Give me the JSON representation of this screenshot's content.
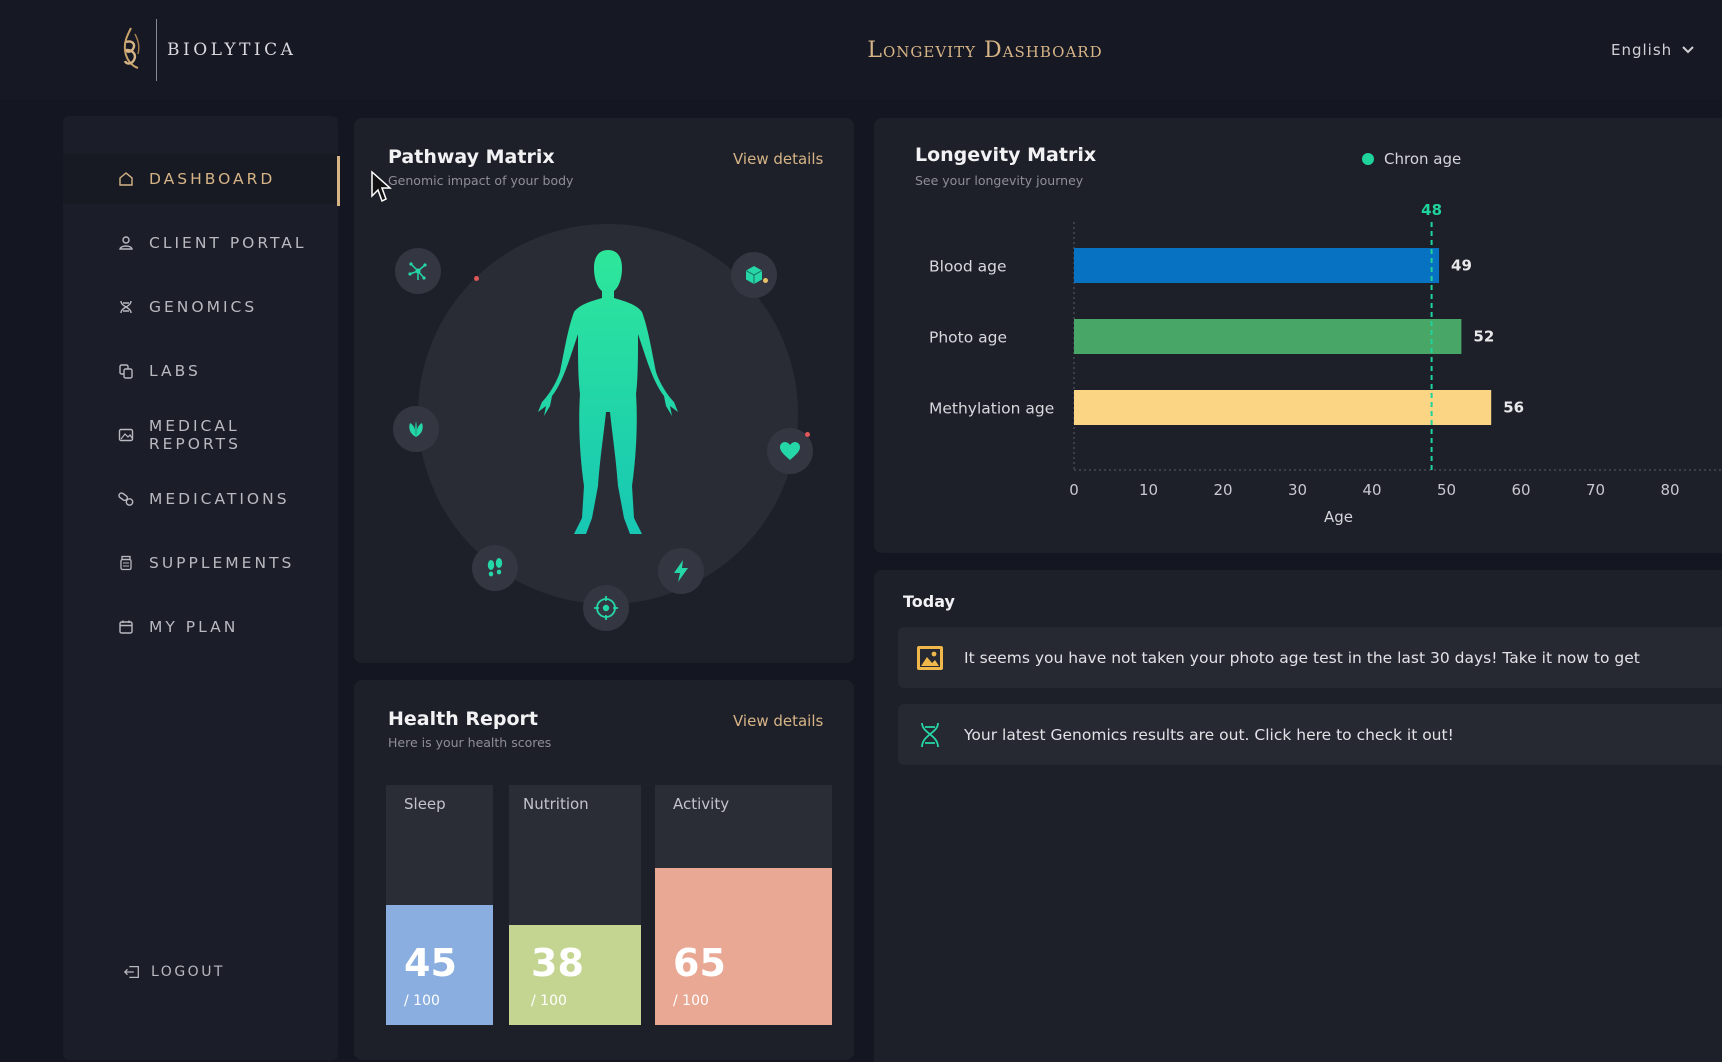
{
  "brand": {
    "name": "BIOLYTICA"
  },
  "header": {
    "title": "Longevity Dashboard",
    "language": "English"
  },
  "sidebar": {
    "items": [
      {
        "label": "DASHBOARD",
        "icon": "home-icon",
        "active": true
      },
      {
        "label": "CLIENT PORTAL",
        "icon": "user-icon"
      },
      {
        "label": "GENOMICS",
        "icon": "dna-icon"
      },
      {
        "label": "LABS",
        "icon": "copy-icon"
      },
      {
        "label": "MEDICAL REPORTS",
        "icon": "image-icon"
      },
      {
        "label": "MEDICATIONS",
        "icon": "pills-icon"
      },
      {
        "label": "SUPPLEMENTS",
        "icon": "jar-icon"
      },
      {
        "label": "MY PLAN",
        "icon": "calendar-icon"
      }
    ],
    "logout": "LOGOUT"
  },
  "pathway": {
    "title": "Pathway Matrix",
    "subtitle": "Genomic impact of your body",
    "link": "View details",
    "icons": [
      "molecule-icon",
      "cube-icon",
      "leaf-icon",
      "heart-icon",
      "footprints-icon",
      "bolt-icon",
      "target-icon"
    ]
  },
  "health": {
    "title": "Health Report",
    "subtitle": "Here is your health scores",
    "link": "View details",
    "scores": [
      {
        "label": "Sleep",
        "value": "45",
        "max": "/ 100",
        "color": "#8aaedf"
      },
      {
        "label": "Nutrition",
        "value": "38",
        "max": "/ 100",
        "color": "#c4d591"
      },
      {
        "label": "Activity",
        "value": "65",
        "max": "/ 100",
        "color": "#e9a894"
      }
    ]
  },
  "longevity": {
    "title": "Longevity Matrix",
    "subtitle": "See your longevity journey",
    "legend": "Chron age",
    "legend_color": "#1fd39c"
  },
  "chart_data": {
    "type": "bar",
    "orientation": "horizontal",
    "categories": [
      "Blood age",
      "Photo age",
      "Methylation age"
    ],
    "values": [
      49,
      52,
      56
    ],
    "colors": [
      "#0772c1",
      "#48a666",
      "#fbd584"
    ],
    "reference_line": {
      "label": "48",
      "value": 48,
      "color": "#1fd39c"
    },
    "xlabel": "Age",
    "xlim": [
      0,
      86
    ],
    "xticks": [
      0,
      10,
      20,
      30,
      40,
      50,
      60,
      70,
      80
    ],
    "grid": false,
    "legend": "top-right"
  },
  "today": {
    "title": "Today",
    "notifications": [
      {
        "text": "It seems you have not taken your photo age test in the last 30 days! Take it now to get",
        "icon": "image-icon"
      },
      {
        "text": "Your latest Genomics results are out. Click here to check it out!",
        "icon": "dna-icon"
      }
    ]
  }
}
